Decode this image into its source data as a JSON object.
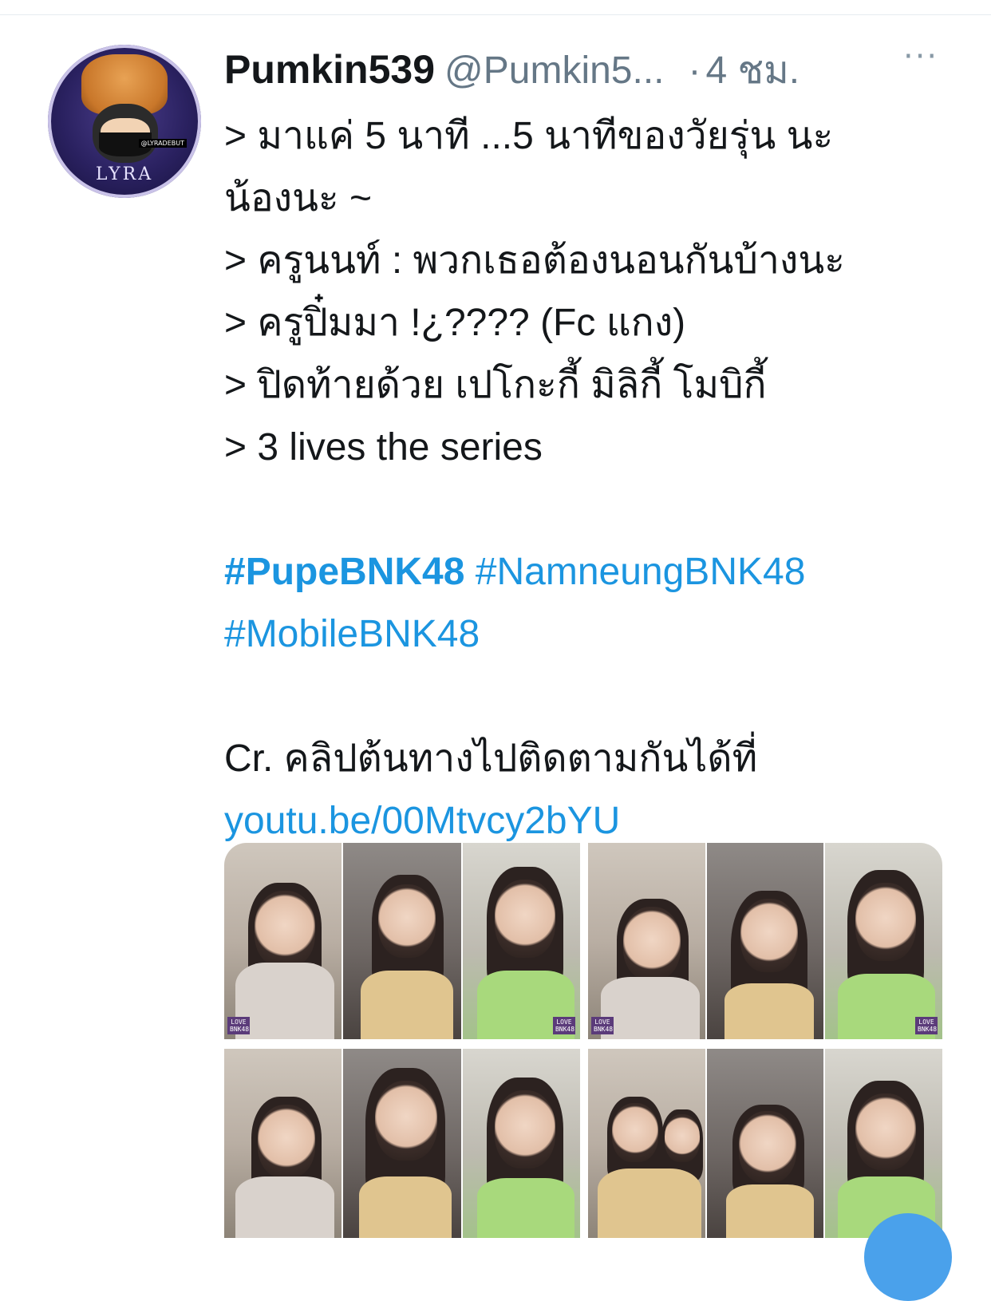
{
  "tweet": {
    "display_name": "Pumkin539",
    "handle": "@Pumkin5...",
    "separator": "·",
    "time": "4 ชม.",
    "more_label": "···",
    "lines": [
      "> มาแค่ 5 นาที ...5 นาทีของวัยรุ่น นะ",
      "น้องนะ ~",
      "> ครูนนท์ : พวกเธอต้องนอนกันบ้างนะ",
      "> ครูปิ๋มมา !¿???? (Fc แกง)",
      "> ปิดท้ายด้วย เปโกะกี้ มิลิกี้ โมบิกี้",
      "> 3 lives the series"
    ],
    "hashtags": [
      "#PupeBNK48",
      "#NamneungBNK48",
      "#MobileBNK48"
    ],
    "credit_text": "Cr. คลิปต้นทางไปติดตามกันได้ที่",
    "credit_link": "youtu.be/00Mtvcy2bYU"
  },
  "avatar": {
    "badge_text": "LYRA",
    "tag_text": "@LYRADEBUT"
  },
  "media": {
    "watermark": "LOVE BNK48"
  },
  "colors": {
    "link": "#1b95e0",
    "text": "#14171a",
    "muted": "#657786"
  }
}
